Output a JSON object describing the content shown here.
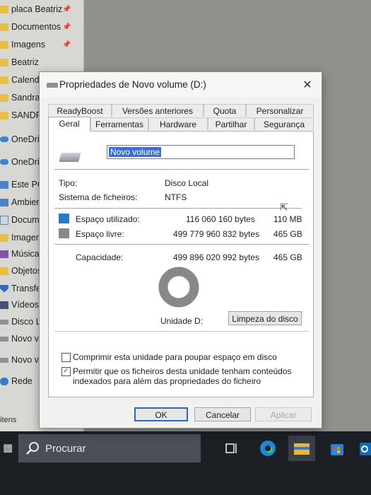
{
  "nav": {
    "items": [
      {
        "label": "placa Beatriz",
        "icon": "folder",
        "pinned": true
      },
      {
        "label": "Documentos",
        "icon": "folder",
        "pinned": true
      },
      {
        "label": "Imagens",
        "icon": "folder",
        "pinned": true
      },
      {
        "label": "Beatriz",
        "icon": "folder",
        "pinned": false
      },
      {
        "label": "Calendá",
        "icon": "folder",
        "pinned": false
      },
      {
        "label": "Sandra",
        "icon": "folder",
        "pinned": false
      },
      {
        "label": "SANDR",
        "icon": "folder",
        "pinned": false
      },
      {
        "label": "OneDrive",
        "icon": "cloud",
        "pinned": false
      },
      {
        "label": "OneDrive",
        "icon": "cloud",
        "pinned": false
      },
      {
        "label": "Este PC",
        "icon": "pc",
        "pinned": false
      },
      {
        "label": "Ambien",
        "icon": "pc",
        "pinned": false
      },
      {
        "label": "Docum",
        "icon": "docs",
        "pinned": false
      },
      {
        "label": "Imagen",
        "icon": "folder",
        "pinned": false
      },
      {
        "label": "Música",
        "icon": "music",
        "pinned": false
      },
      {
        "label": "Objetos",
        "icon": "folder",
        "pinned": false
      },
      {
        "label": "Transfe",
        "icon": "down",
        "pinned": false
      },
      {
        "label": "Vídeos",
        "icon": "video",
        "pinned": false
      },
      {
        "label": "Disco L",
        "icon": "drive",
        "pinned": false
      },
      {
        "label": "Novo vo",
        "icon": "drive",
        "pinned": false
      },
      {
        "label": "Novo vol",
        "icon": "drive",
        "pinned": false
      },
      {
        "label": "Rede",
        "icon": "net",
        "pinned": false
      }
    ],
    "status_text": "itens"
  },
  "taskbar": {
    "search_placeholder": "Procurar"
  },
  "dialog": {
    "title": "Propriedades de Novo volume (D:)",
    "close_glyph": "✕",
    "tabs_back": [
      "ReadyBoost",
      "Versões anteriores",
      "Quota",
      "Personalizar"
    ],
    "tabs_front": [
      "Geral",
      "Ferramentas",
      "Hardware",
      "Partilhar",
      "Segurança"
    ],
    "selected_tab": "Geral",
    "volume_name": "Novo volume",
    "type_label": "Tipo:",
    "type_value": "Disco Local",
    "fs_label": "Sistema de ficheiros:",
    "fs_value": "NTFS",
    "used_label": "Espaço utilizado:",
    "used_bytes": "116 060 160 bytes",
    "used_size": "110 MB",
    "free_label": "Espaço livre:",
    "free_bytes": "499 779 960 832 bytes",
    "free_size": "465 GB",
    "cap_label": "Capacidade:",
    "cap_bytes": "499 896 020 992 bytes",
    "cap_size": "465 GB",
    "used_fraction": 0.00023,
    "drive_label": "Unidade D:",
    "cleanup_button": "Limpeza do disco",
    "compress_label": "Comprimir esta unidade para poupar espaço em disco",
    "compress_checked": false,
    "index_label_1": "Permitir que os ficheiros desta unidade tenham conteúdos",
    "index_label_2": "indexados para além das propriedades do ficheiro",
    "index_checked": true,
    "ok": "OK",
    "cancel": "Cancelar",
    "apply": "Aplicar",
    "colors": {
      "used": "#2a78c8",
      "free": "#888888"
    }
  }
}
